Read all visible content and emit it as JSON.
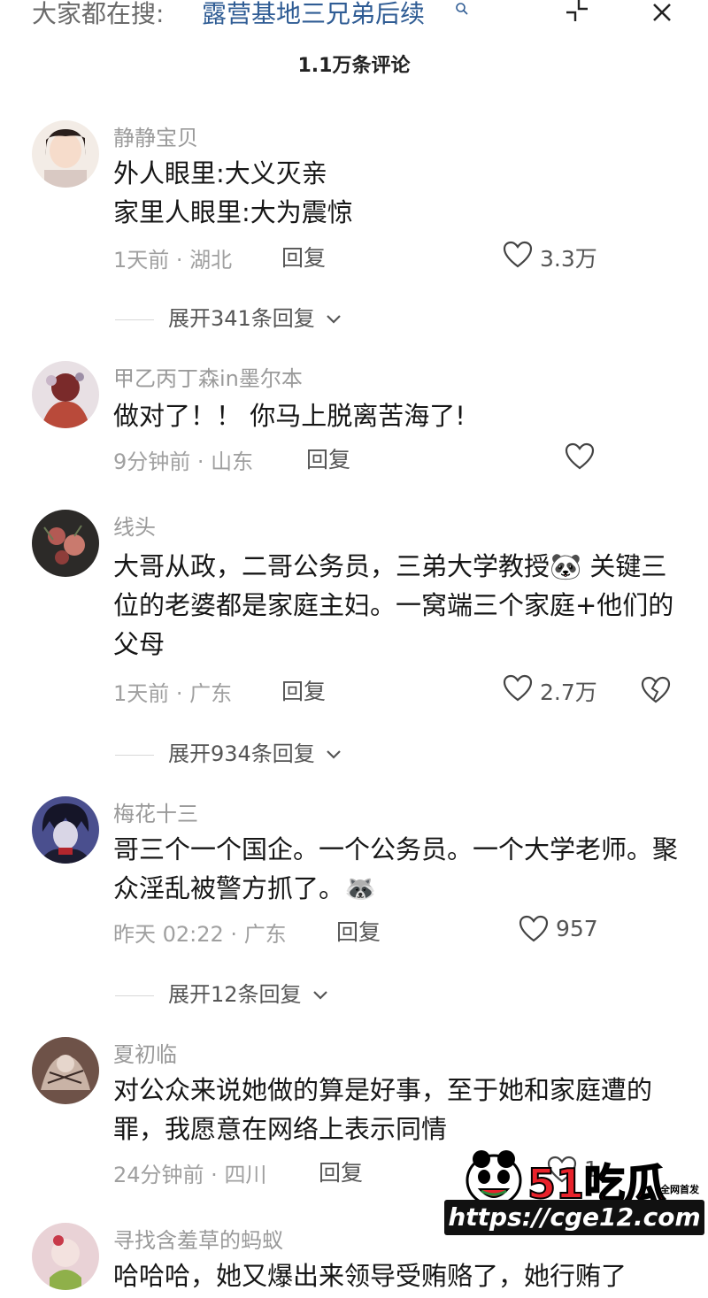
{
  "topbar": {
    "search_prefix": "大家都在搜:",
    "search_term": "露营基地三兄弟后续"
  },
  "comment_count": "1.1万条评论",
  "comments": [
    {
      "username": "静静宝贝",
      "text": "外人眼里:大义灭亲\n家里人眼里:大为震惊",
      "time": "1天前",
      "location": "湖北",
      "reply_label": "回复",
      "likes": "3.3万",
      "expand_label": "展开341条回复"
    },
    {
      "username": "甲乙丙丁森in墨尔本",
      "text": "做对了！！ 你马上脱离苦海了!",
      "time": "9分钟前",
      "location": "山东",
      "reply_label": "回复",
      "likes": ""
    },
    {
      "username": "线头",
      "text": "大哥从政，二哥公务员，三弟大学教授🐼 关键三位的老婆都是家庭主妇。一窝端三个家庭+他们的父母",
      "time": "1天前",
      "location": "广东",
      "reply_label": "回复",
      "likes": "2.7万",
      "expand_label": "展开934条回复"
    },
    {
      "username": "梅花十三",
      "text": "哥三个一个国企。一个公务员。一个大学老师。聚众淫乱被警方抓了。🦝",
      "time": "昨天 02:22",
      "location": "广东",
      "reply_label": "回复",
      "likes": "957",
      "expand_label": "展开12条回复"
    },
    {
      "username": "夏初临",
      "text": "对公众来说她做的算是好事，至于她和家庭遭的罪，我愿意在网络上表示同情",
      "time": "24分钟前",
      "location": "四川",
      "reply_label": "回复",
      "likes": "1"
    },
    {
      "username": "寻找含羞草的蚂蚁",
      "text": "哈哈哈，她又爆出来领导受贿赂了，她行贿了",
      "time": "",
      "location": "",
      "reply_label": ""
    }
  ],
  "watermark": {
    "brand": "51吃瓜",
    "sub": "全网首发",
    "url": "https://cge12.com"
  },
  "colors": {
    "link_blue": "#2f5c94",
    "meta_gray": "#a0a0a0",
    "watermark_red": "#e8222b"
  }
}
